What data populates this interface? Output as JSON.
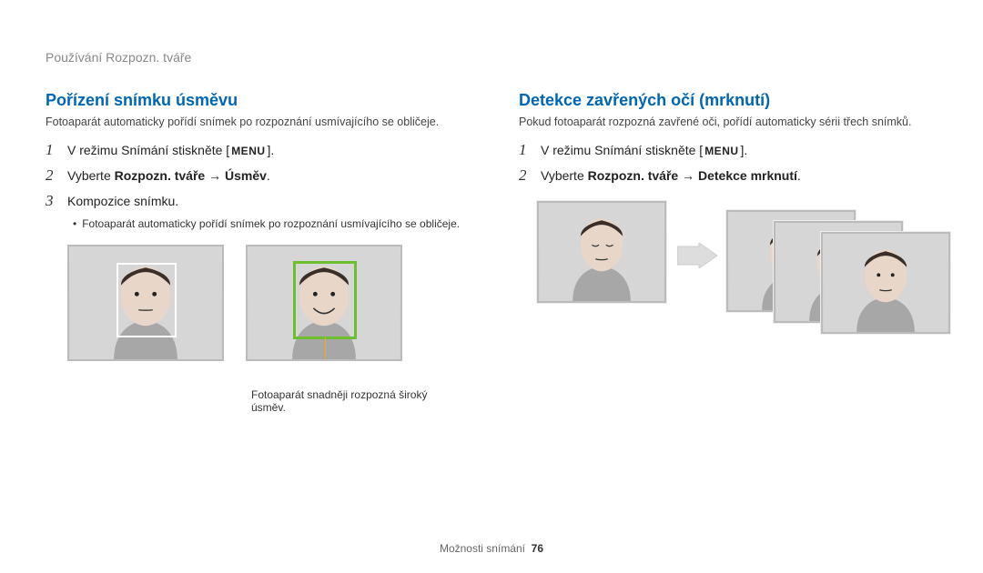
{
  "running_head": "Používání Rozpozn. tváře",
  "footer": {
    "section": "Možnosti snímání",
    "page": "76"
  },
  "menu_glyph": "MENU",
  "left": {
    "title": "Pořízení snímku úsměvu",
    "lead": "Fotoaparát automaticky pořídí snímek po rozpoznání usmívajícího se obličeje.",
    "step1_pre": "V režimu Snímání stiskněte [",
    "step1_post": "].",
    "step2_pre": "Vyberte ",
    "step2_bold": "Rozpozn. tváře → Úsměv",
    "step2_post": ".",
    "step3": "Kompozice snímku.",
    "step3_sub": "Fotoaparát automaticky pořídí snímek po rozpoznání usmívajícího se obličeje.",
    "caption": "Fotoaparát snadněji rozpozná široký úsměv."
  },
  "right": {
    "title": "Detekce zavřených očí (mrknutí)",
    "lead": "Pokud fotoaparát rozpozná zavřené oči, pořídí automaticky sérii třech snímků.",
    "step1_pre": "V režimu Snímání stiskněte [",
    "step1_post": "].",
    "step2_pre": "Vyberte ",
    "step2_bold": "Rozpozn. tváře → Detekce mrknutí",
    "step2_post": "."
  },
  "nums": {
    "one": "1",
    "two": "2",
    "three": "3"
  }
}
